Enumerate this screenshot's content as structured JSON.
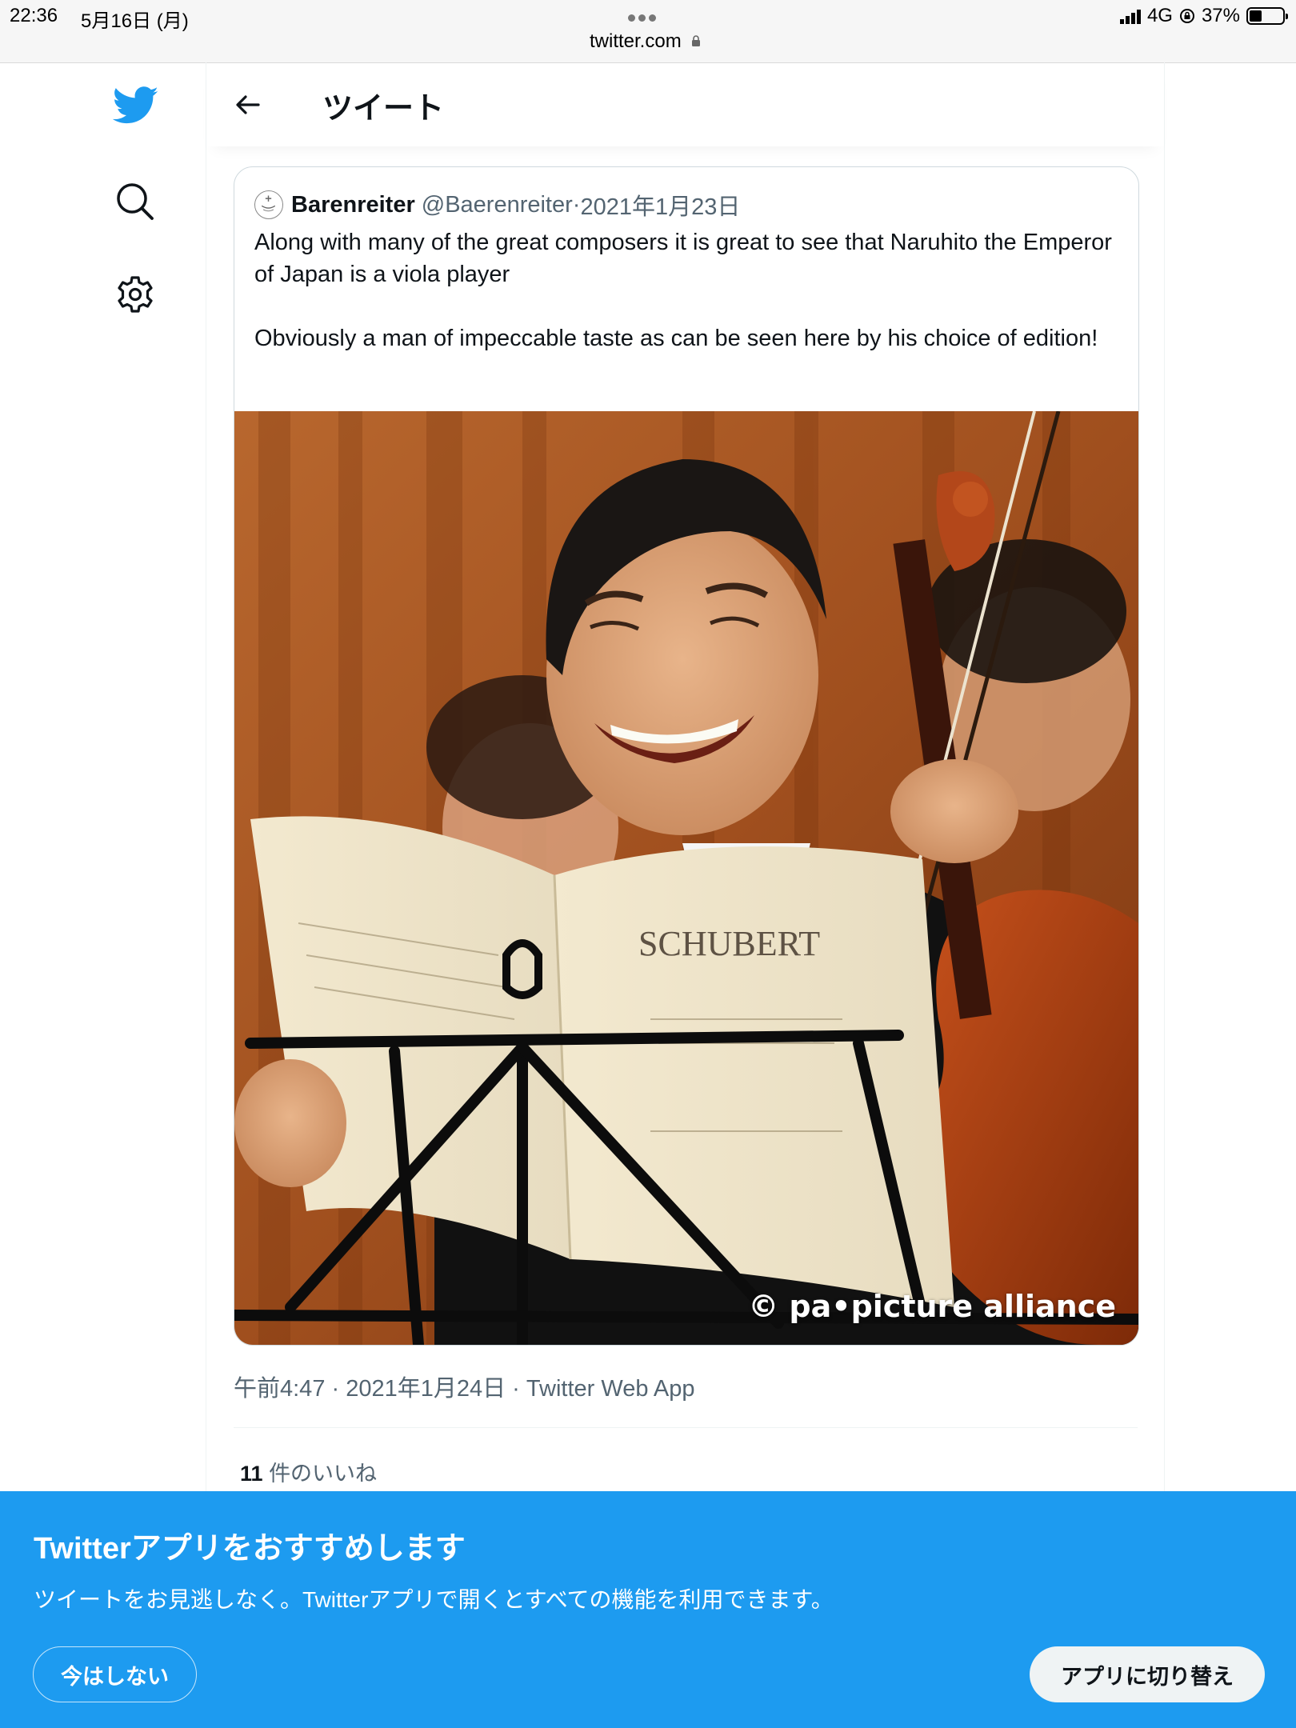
{
  "status_bar": {
    "time": "22:36",
    "date": "5月16日 (月)",
    "url": "twitter.com",
    "network": "4G",
    "battery": "37%",
    "battery_level": 0.37
  },
  "nav": {
    "icons": [
      "twitter-bird-icon",
      "search-icon",
      "gear-icon"
    ],
    "brand_color": "#1d9bf0"
  },
  "header": {
    "title": "ツイート"
  },
  "quoted_tweet": {
    "name": "Barenreiter",
    "handle": "@Baerenreiter",
    "separator": " · ",
    "date": "2021年1月23日",
    "text": "Along with many of the great composers it is great to see that Naruhito the Emperor of Japan is a viola player\n\nObviously a man of impeccable taste as can be seen here by his choice of edition!",
    "image": {
      "sheet_title": "SCHUBERT",
      "watermark": "© pa•picture alliance"
    }
  },
  "tweet_meta": {
    "text": "午前4:47 · 2021年1月24日 · Twitter Web App"
  },
  "likes": {
    "count": "11",
    "label": "件のいいね"
  },
  "banner": {
    "title": "Twitterアプリをおすすめします",
    "description": "ツイートをお見逃しなく。Twitterアプリで開くとすべての機能を利用できます。",
    "dismiss_label": "今はしない",
    "switch_label": "アプリに切り替え",
    "bg_color": "#1d9bf0"
  }
}
